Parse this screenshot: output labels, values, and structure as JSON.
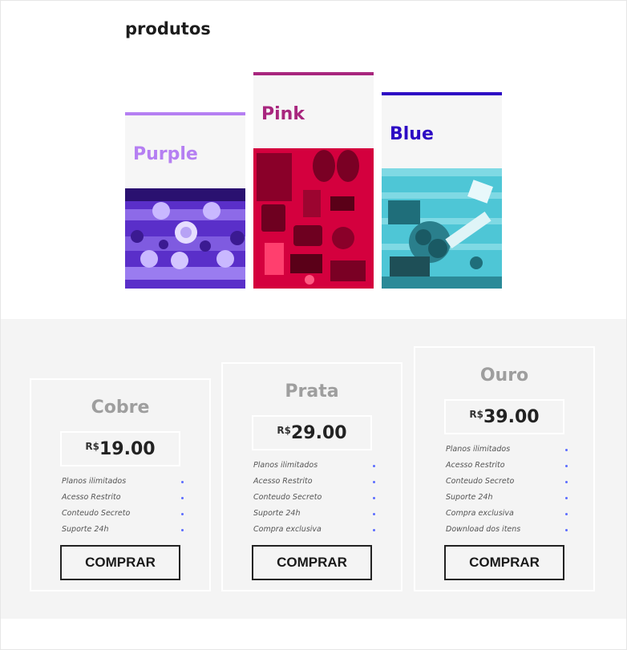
{
  "products": {
    "title": "produtos",
    "cards": [
      {
        "name": "Purple",
        "color": "#b57ff2",
        "image_icon": "table-setting-photo"
      },
      {
        "name": "Pink",
        "color": "#a8267e",
        "image_icon": "travel-gear-photo"
      },
      {
        "name": "Blue",
        "color": "#2d0bc4",
        "image_icon": "desk-flowers-photo"
      }
    ]
  },
  "pricing": {
    "buy_label": "COMPRAR",
    "currency": "R$",
    "feature_dot_color": "#5b6cff",
    "plans": [
      {
        "name": "Cobre",
        "price": "19.00",
        "features": [
          "Planos ilimitados",
          "Acesso Restrito",
          "Conteudo Secreto",
          "Suporte 24h"
        ]
      },
      {
        "name": "Prata",
        "price": "29.00",
        "features": [
          "Planos ilimitados",
          "Acesso Restrito",
          "Conteudo Secreto",
          "Suporte 24h",
          "Compra exclusiva"
        ]
      },
      {
        "name": "Ouro",
        "price": "39.00",
        "features": [
          "Planos ilimitados",
          "Acesso Restrito",
          "Conteudo Secreto",
          "Suporte 24h",
          "Compra exclusiva",
          "Download dos itens"
        ]
      }
    ]
  }
}
